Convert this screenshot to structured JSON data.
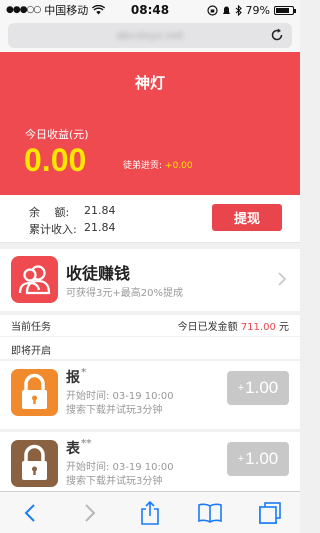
{
  "status_bar": {
    "carrier": "中国移动",
    "time": "08:48",
    "battery": "79%",
    "battery_level": 0.79
  },
  "browser": {
    "url": "abcdxyz.net"
  },
  "hero": {
    "title": "神灯",
    "earnings_label": "今日收益(元)",
    "earnings_value": "0.00",
    "apprentice_label": "徒弟进贡:",
    "apprentice_value": "+0.00"
  },
  "balance": {
    "balance_label": "余　 额:",
    "balance_value": "21.84",
    "total_label": "累计收入:",
    "total_value": "21.84",
    "withdraw_label": "提现"
  },
  "recruit": {
    "title": "收徒赚钱",
    "subtitle": "可获得3元+最高20%提成"
  },
  "tasks_section": {
    "current_label": "当前任务",
    "issued_prefix": "今日已发金额",
    "issued_amount": "711.00",
    "issued_suffix": "元",
    "upcoming_label": "即将开启"
  },
  "tasks": [
    {
      "name": "报",
      "stars": "*",
      "time": "开始时间: 03-19 10:00",
      "desc": "搜索下载并试玩3分钟",
      "reward_plus": "+",
      "reward_value": "1.00",
      "icon_color": "#f08a2c"
    },
    {
      "name": "表",
      "stars": "**",
      "time": "开始时间: 03-19 10:00",
      "desc": "搜索下载并试玩3分钟",
      "reward_plus": "+",
      "reward_value": "1.00",
      "icon_color": "#8a6242"
    }
  ],
  "colors": {
    "accent_red": "#ef4a4f",
    "yellow": "#ffe600"
  }
}
